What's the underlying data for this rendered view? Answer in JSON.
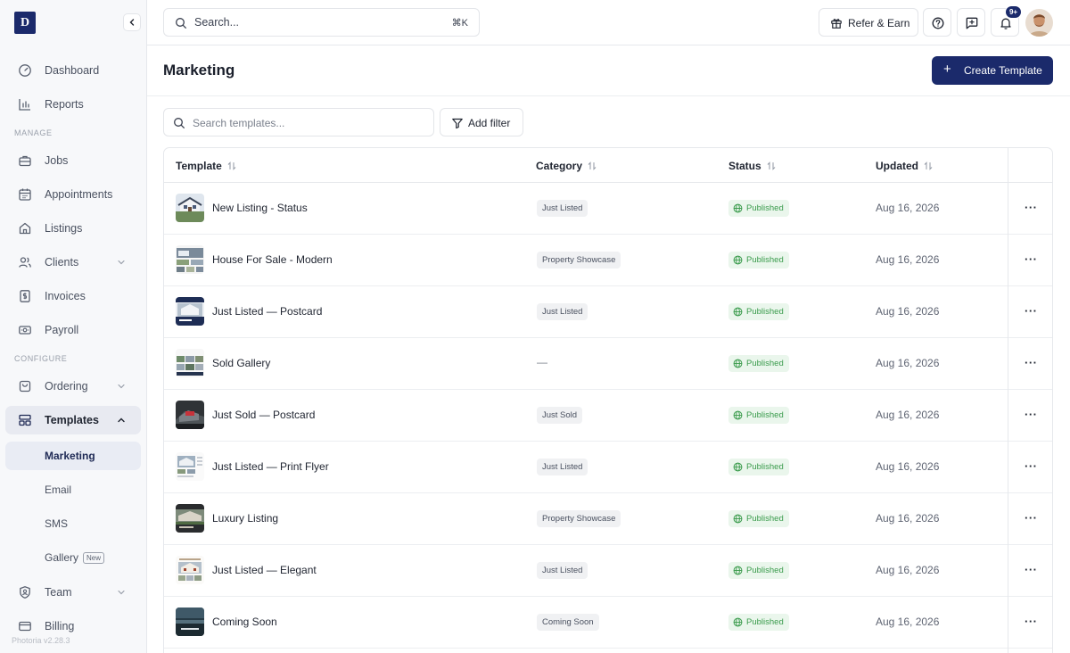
{
  "app": {
    "logo_letter": "D",
    "version": "Photoria v2.28.3"
  },
  "sidebar": {
    "items": [
      {
        "label": "Dashboard"
      },
      {
        "label": "Reports"
      },
      {
        "section": "MANAGE"
      },
      {
        "label": "Jobs"
      },
      {
        "label": "Appointments"
      },
      {
        "label": "Listings"
      },
      {
        "label": "Clients"
      },
      {
        "label": "Invoices"
      },
      {
        "label": "Payroll"
      },
      {
        "section": "CONFIGURE"
      },
      {
        "label": "Ordering"
      },
      {
        "label": "Templates"
      },
      {
        "label": "Team"
      },
      {
        "label": "Billing"
      }
    ],
    "sub_items": [
      {
        "label": "Marketing"
      },
      {
        "label": "Email"
      },
      {
        "label": "SMS"
      },
      {
        "label": "Gallery",
        "badge": "New"
      }
    ]
  },
  "topbar": {
    "search_placeholder": "Search...",
    "search_shortcut": "⌘K",
    "refer_label": "Refer & Earn",
    "notification_count": "9+"
  },
  "page": {
    "title": "Marketing",
    "create_label": "Create Template",
    "search_placeholder": "Search templates...",
    "filter_label": "Add filter"
  },
  "table": {
    "columns": [
      "Template",
      "Category",
      "Status",
      "Updated"
    ],
    "rows": [
      {
        "name": "New Listing - Status",
        "category": "Just Listed",
        "status": "Published",
        "updated": "Aug 16, 2026",
        "thumb": "house-white"
      },
      {
        "name": "House For Sale - Modern",
        "category": "Property Showcase",
        "status": "Published",
        "updated": "Aug 16, 2026",
        "thumb": "collage"
      },
      {
        "name": "Just Listed — Postcard",
        "category": "Just Listed",
        "status": "Published",
        "updated": "Aug 16, 2026",
        "thumb": "postcard-navy"
      },
      {
        "name": "Sold Gallery",
        "category": "—",
        "status": "Published",
        "updated": "Aug 16, 2026",
        "thumb": "gallery"
      },
      {
        "name": "Just Sold — Postcard",
        "category": "Just Sold",
        "status": "Published",
        "updated": "Aug 16, 2026",
        "thumb": "sold-dark"
      },
      {
        "name": "Just Listed — Print Flyer",
        "category": "Just Listed",
        "status": "Published",
        "updated": "Aug 16, 2026",
        "thumb": "flyer"
      },
      {
        "name": "Luxury Listing",
        "category": "Property Showcase",
        "status": "Published",
        "updated": "Aug 16, 2026",
        "thumb": "luxury"
      },
      {
        "name": "Just Listed — Elegant",
        "category": "Just Listed",
        "status": "Published",
        "updated": "Aug 16, 2026",
        "thumb": "elegant"
      },
      {
        "name": "Coming Soon",
        "category": "Coming Soon",
        "status": "Published",
        "updated": "Aug 16, 2026",
        "thumb": "coming-soon"
      }
    ],
    "row_action_label": "···"
  },
  "colors": {
    "accent": "#1b2a6b",
    "published_text": "#3a9b4c",
    "published_bg": "#eaf6ec"
  }
}
